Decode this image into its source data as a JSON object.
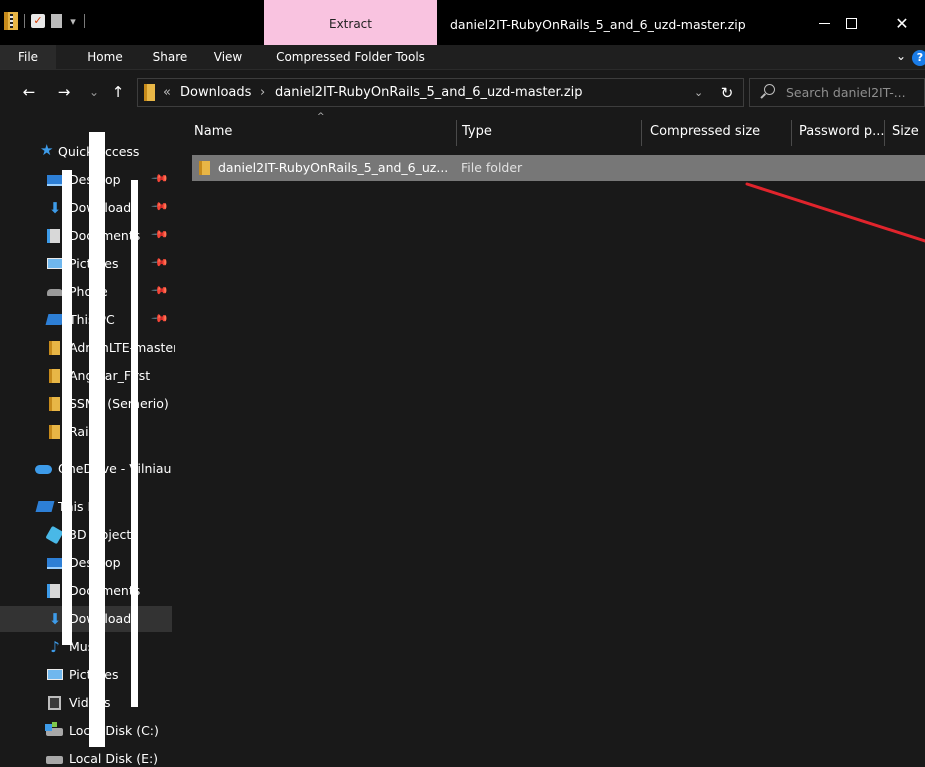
{
  "window": {
    "title": "daniel2IT-RubyOnRails_5_and_6_uzd-master.zip",
    "context_tab": "Extract",
    "controls": {
      "minimize": "—",
      "maximize": "",
      "close": "✕"
    },
    "qa_dropdown": "▾"
  },
  "ribbon": {
    "tabs": [
      {
        "label": "File"
      },
      {
        "label": "Home"
      },
      {
        "label": "Share"
      },
      {
        "label": "View"
      },
      {
        "label": "Compressed Folder Tools"
      }
    ],
    "chevron": "⌄",
    "help": "?"
  },
  "address": {
    "nav": {
      "back": "←",
      "forward": "→",
      "recent": "⌄",
      "up": "↑"
    },
    "overflow": "«",
    "crumbs": [
      "Downloads",
      "daniel2IT-RubyOnRails_5_and_6_uzd-master.zip"
    ],
    "separator": "›",
    "dropdown": "⌄",
    "refresh": "↻",
    "search_placeholder": "Search daniel2IT-..."
  },
  "nav_pane": {
    "quick_access": "Quick access",
    "items": [
      {
        "label": "Desktop",
        "icon": "desktop-icon"
      },
      {
        "label": "Downloads",
        "icon": "downloads-icon"
      },
      {
        "label": "Documents",
        "icon": "documents-icon"
      },
      {
        "label": "Pictures",
        "icon": "pictures-icon"
      },
      {
        "label": "Phone",
        "icon": "phone-icon"
      },
      {
        "label": "This PC",
        "icon": "pc-icon"
      },
      {
        "label": "AdminLTE-master",
        "icon": "folder-icon"
      },
      {
        "label": "Angular_First",
        "icon": "folder-icon"
      },
      {
        "label": "SSMT (Semerio)",
        "icon": "folder-icon"
      },
      {
        "label": "Rails",
        "icon": "folder-icon"
      }
    ],
    "onedrive": "OneDrive - Vilniau",
    "this_pc": "This PC",
    "pc_items": [
      {
        "label": "3D Objects",
        "icon": "3d-objects-icon"
      },
      {
        "label": "Desktop",
        "icon": "desktop-icon"
      },
      {
        "label": "Documents",
        "icon": "documents-icon"
      },
      {
        "label": "Downloads",
        "icon": "downloads-icon",
        "selected": true
      },
      {
        "label": "Music",
        "icon": "music-icon"
      },
      {
        "label": "Pictures",
        "icon": "pictures-icon"
      },
      {
        "label": "Videos",
        "icon": "videos-icon"
      },
      {
        "label": "Local Disk (C:)",
        "icon": "local-disk-c-icon"
      },
      {
        "label": "Local Disk (E:)",
        "icon": "local-disk-e-icon"
      }
    ]
  },
  "file_list": {
    "columns": [
      "Name",
      "Type",
      "Compressed size",
      "Password p...",
      "Size"
    ],
    "sort_indicator": "^",
    "rows": [
      {
        "name": "daniel2IT-RubyOnRails_5_and_6_uz...",
        "type": "File folder"
      }
    ]
  },
  "colors": {
    "background": "#191919",
    "titlebar": "#000000",
    "context_tab": "#f9c3e0",
    "selected_row": "#777777",
    "folder": "#e8b646",
    "accent": "#3d9be9",
    "annotation": "#e0242c"
  }
}
